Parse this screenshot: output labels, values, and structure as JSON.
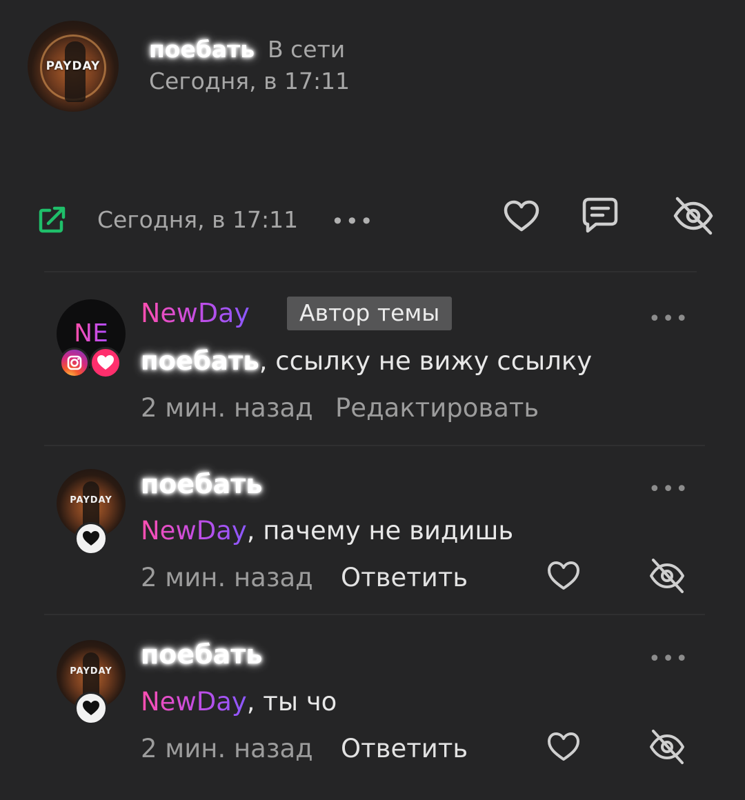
{
  "post": {
    "author": "поебать",
    "online_status": "В сети",
    "timestamp": "Сегодня, в 17:11",
    "avatar_logo_text": "PAYDAY"
  },
  "action_bar": {
    "timestamp": "Сегодня, в 17:11",
    "more_label": "•••",
    "icons": [
      "share-icon",
      "heart-icon",
      "comment-icon",
      "eye-off-icon"
    ],
    "accent_color": "#1fbf6a"
  },
  "comments": [
    {
      "author": "NewDay",
      "author_badge": "Автор темы",
      "avatar_text": "NE",
      "mention": "поебать",
      "text": ", ссылку не вижу ссылку",
      "time": "2 мин. назад",
      "action": "Редактировать",
      "more_label": "•••"
    },
    {
      "author": "поебать",
      "mention": "NewDay",
      "text": ", пачему не видишь",
      "time": "2 мин. назад",
      "action": "Ответить",
      "more_label": "•••"
    },
    {
      "author": "поебать",
      "mention": "NewDay",
      "text": ", ты чо",
      "time": "2 мин. назад",
      "action": "Ответить",
      "more_label": "•••"
    }
  ],
  "colors": {
    "background": "#252526",
    "name_gradient_start": "#ff4fb0",
    "name_gradient_end": "#8a58ff",
    "author_badge_bg": "#555556"
  }
}
